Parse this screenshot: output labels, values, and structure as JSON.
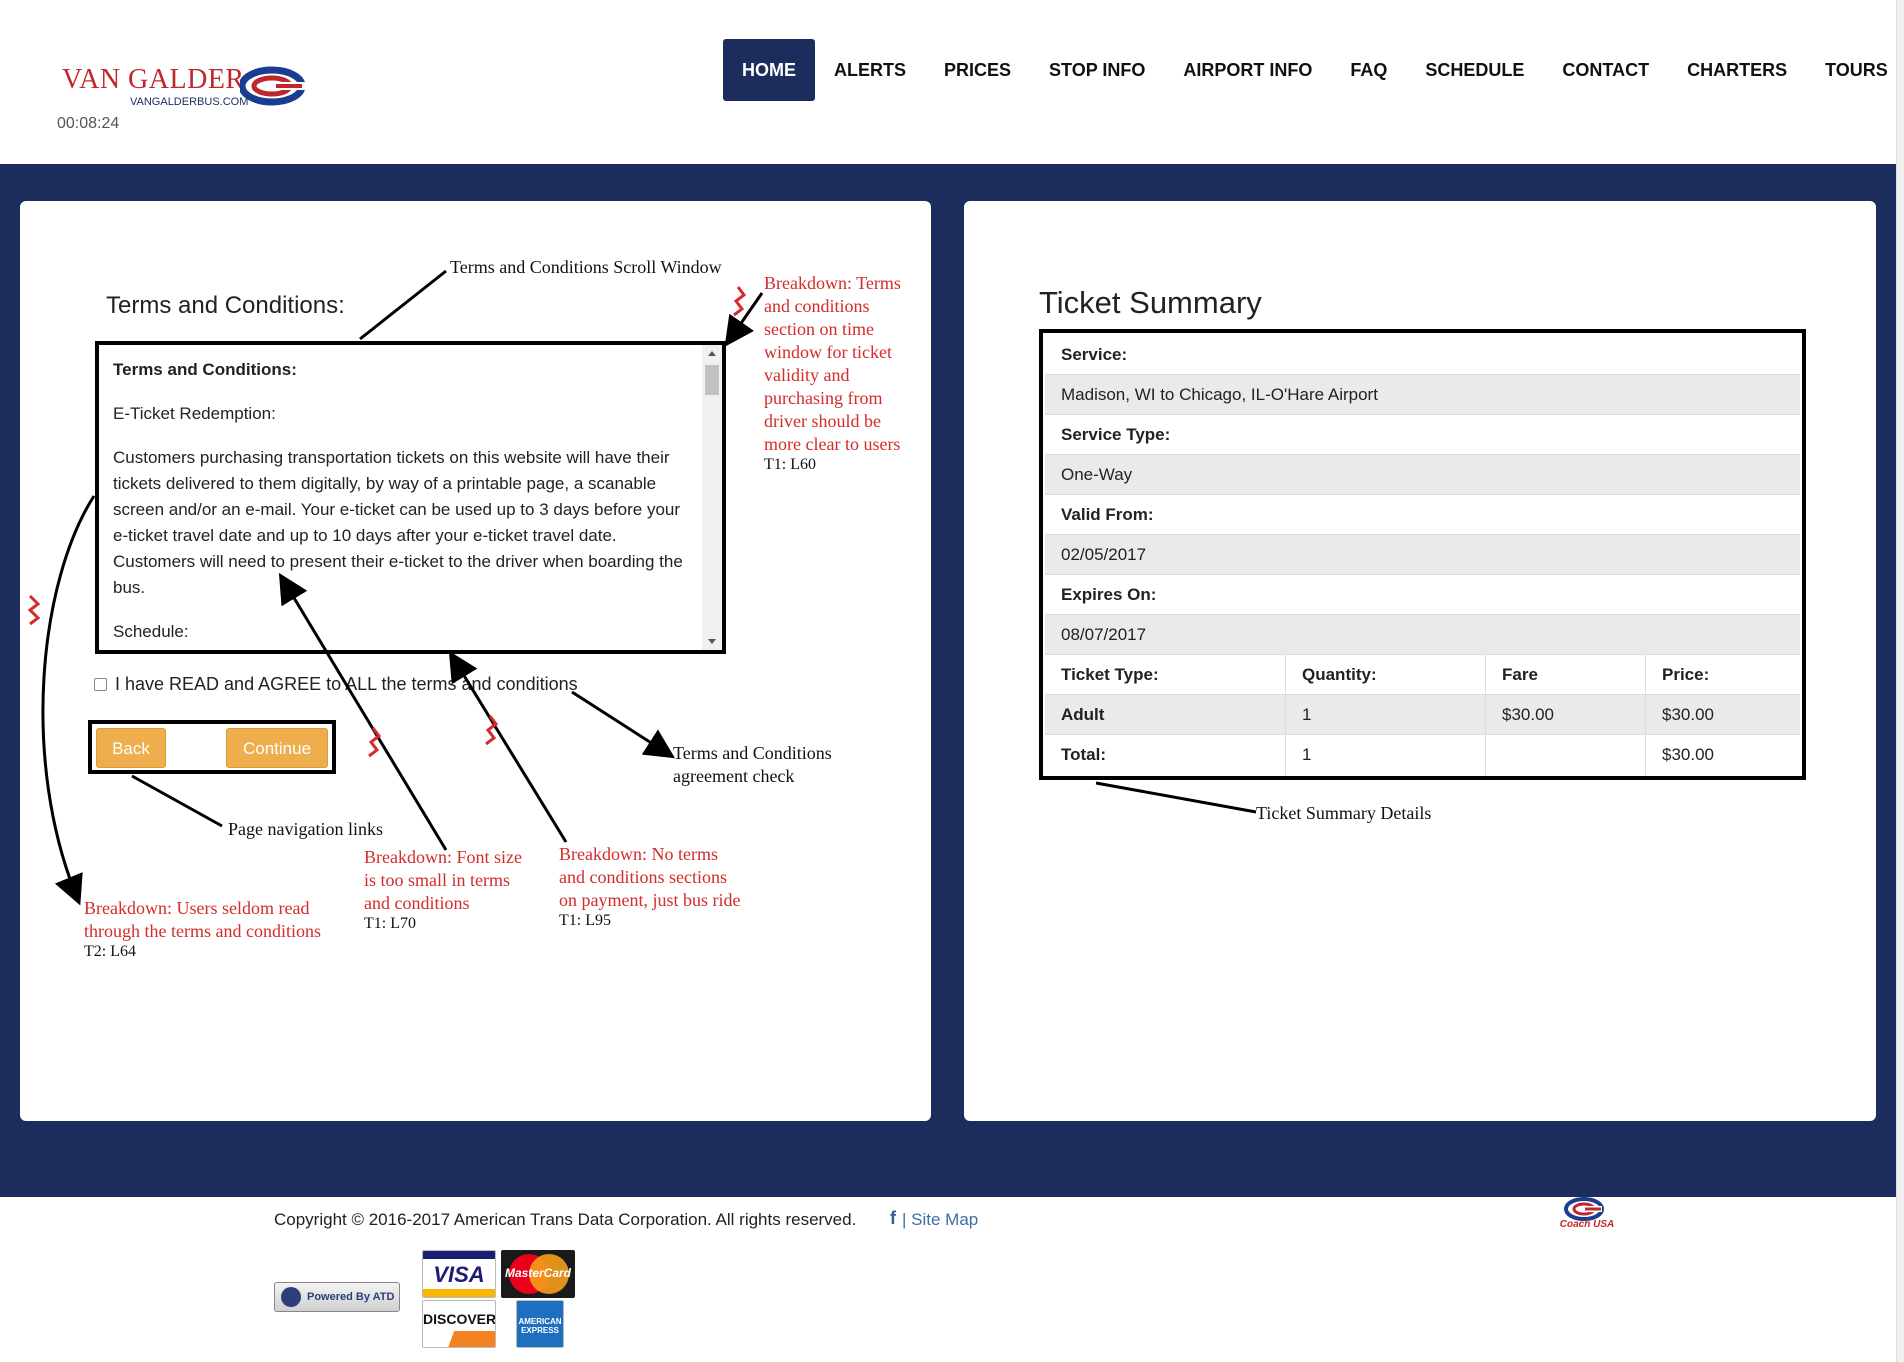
{
  "header": {
    "logo_text": "VAN GALDER",
    "logo_url": "VANGALDERBUS.COM",
    "timer": "00:08:24",
    "nav": [
      "HOME",
      "ALERTS",
      "PRICES",
      "STOP INFO",
      "AIRPORT INFO",
      "FAQ",
      "SCHEDULE",
      "CONTACT",
      "CHARTERS",
      "TOURS"
    ],
    "active_nav": "HOME"
  },
  "terms": {
    "heading": "Terms and Conditions:",
    "box_title": "Terms and Conditions:",
    "section1": "E-Ticket Redemption:",
    "body": "Customers purchasing transportation tickets on this website will have their tickets delivered to them digitally, by way of a printable page, a scanable screen and/or an e-mail. Your e-ticket can be used up to 3 days before your e-ticket travel date and up to 10 days after your e-ticket travel date. Customers will need to present their e-ticket to the driver when boarding the bus.",
    "section2": "Schedule:",
    "agree_label": "I have READ and AGREE to ALL the terms and conditions",
    "back_label": "Back",
    "continue_label": "Continue"
  },
  "annotations": {
    "scroll_window": "Terms and Conditions Scroll Window",
    "agreement_check": [
      "Terms and Conditions",
      "agreement check"
    ],
    "page_nav": "Page navigation links",
    "ticket_details": "Ticket Summary Details",
    "breakdown_time": {
      "lines": [
        "Breakdown: Terms",
        "and conditions",
        "section on time",
        "window for ticket",
        "validity and",
        "purchasing from",
        "driver should be",
        "more clear to users"
      ],
      "ref": "T1: L60"
    },
    "breakdown_font": {
      "lines": [
        "Breakdown: Font size",
        "is too small in terms",
        "and conditions"
      ],
      "ref": "T1: L70"
    },
    "breakdown_payment": {
      "lines": [
        "Breakdown: No terms",
        "and conditions sections",
        "on payment, just bus ride"
      ],
      "ref": "T1: L95"
    },
    "breakdown_read": {
      "lines": [
        "Breakdown: Users seldom read",
        "through the terms and conditions"
      ],
      "ref": "T2: L64"
    }
  },
  "ticket_summary": {
    "heading": "Ticket Summary",
    "service_label": "Service:",
    "service_value": "Madison, WI to Chicago, IL-O'Hare Airport",
    "service_type_label": "Service Type:",
    "service_type_value": "One-Way",
    "valid_from_label": "Valid From:",
    "valid_from_value": "02/05/2017",
    "expires_label": "Expires On:",
    "expires_value": "08/07/2017",
    "columns": [
      "Ticket Type:",
      "Quantity:",
      "Fare",
      "Price:"
    ],
    "rows": [
      [
        "Adult",
        "1",
        "$30.00",
        "$30.00"
      ],
      [
        "Total:",
        "1",
        "",
        "$30.00"
      ]
    ]
  },
  "footer": {
    "copyright": "Copyright © 2016-2017 American Trans Data Corporation. All rights reserved.",
    "fb_icon": "f",
    "sitemap": "| Site Map",
    "powered": "Powered By ATD",
    "cards": [
      "VISA",
      "MasterCard",
      "DISCOVER",
      "AMERICAN EXPRESS"
    ],
    "coach_logo": "Coach USA"
  },
  "colors": {
    "navy": "#1c2c5c",
    "orange_button": "#efae4e",
    "annotation_red": "#d42b2b",
    "brand_red": "#c0272d"
  }
}
